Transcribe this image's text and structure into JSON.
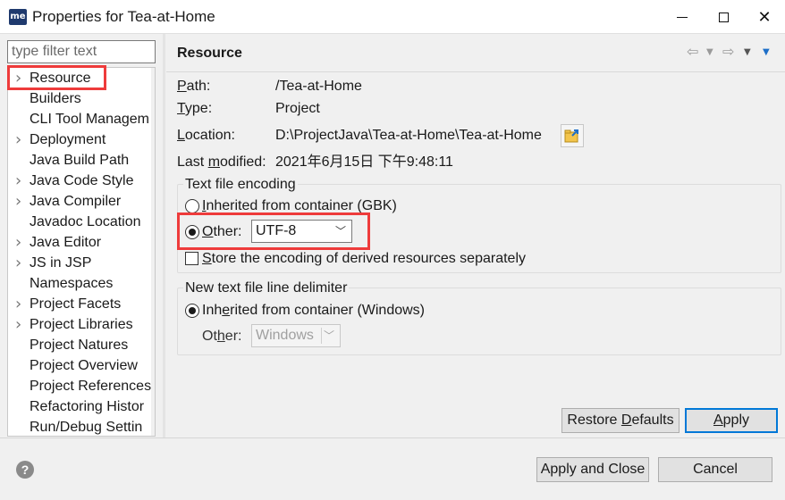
{
  "window": {
    "app_icon": "me",
    "title": "Properties for Tea-at-Home",
    "minimize_icon": "minimize-icon",
    "maximize_icon": "maximize-icon",
    "close_icon": "close-icon"
  },
  "filter": {
    "placeholder": "type filter text",
    "value": ""
  },
  "tree": {
    "items": [
      {
        "label": "Resource",
        "expandable": true,
        "selected": true
      },
      {
        "label": "Builders",
        "expandable": false
      },
      {
        "label": "CLI Tool Managem",
        "expandable": false
      },
      {
        "label": "Deployment",
        "expandable": true
      },
      {
        "label": "Java Build Path",
        "expandable": false
      },
      {
        "label": "Java Code Style",
        "expandable": true
      },
      {
        "label": "Java Compiler",
        "expandable": true
      },
      {
        "label": "Javadoc Location",
        "expandable": false
      },
      {
        "label": "Java Editor",
        "expandable": true
      },
      {
        "label": "JS in JSP",
        "expandable": true
      },
      {
        "label": "Namespaces",
        "expandable": false
      },
      {
        "label": "Project Facets",
        "expandable": true
      },
      {
        "label": "Project Libraries",
        "expandable": true
      },
      {
        "label": "Project Natures",
        "expandable": false
      },
      {
        "label": "Project Overview",
        "expandable": false
      },
      {
        "label": "Project References",
        "expandable": false
      },
      {
        "label": "Refactoring Histor",
        "expandable": false
      },
      {
        "label": "Run/Debug Settin",
        "expandable": false
      }
    ]
  },
  "panel": {
    "title": "Resource",
    "path_label": "Path:",
    "path_value": "/Tea-at-Home",
    "type_label": "Type:",
    "type_value": "Project",
    "location_label": "Location:",
    "location_value": "D:\\ProjectJava\\Tea-at-Home\\Tea-at-Home",
    "modified_label": "Last modified:",
    "modified_value": "2021年6月15日 下午9:48:11"
  },
  "encoding": {
    "group_title": "Text file encoding",
    "inherited_label": "Inherited from container (GBK)",
    "other_label": "Other:",
    "other_value": "UTF-8",
    "store_label": "Store the encoding of derived resources separately",
    "selected": "other"
  },
  "delimiter": {
    "group_title": "New text file line delimiter",
    "inherited_label": "Inherited from container (Windows)",
    "other_label": "Other:",
    "other_value": "Windows",
    "selected": "inherited"
  },
  "buttons": {
    "restore_defaults": "Restore Defaults",
    "apply": "Apply",
    "apply_and_close": "Apply and Close",
    "cancel": "Cancel"
  },
  "colors": {
    "highlight_box": "#ee3b3b",
    "default_button_border": "#0078d7"
  }
}
